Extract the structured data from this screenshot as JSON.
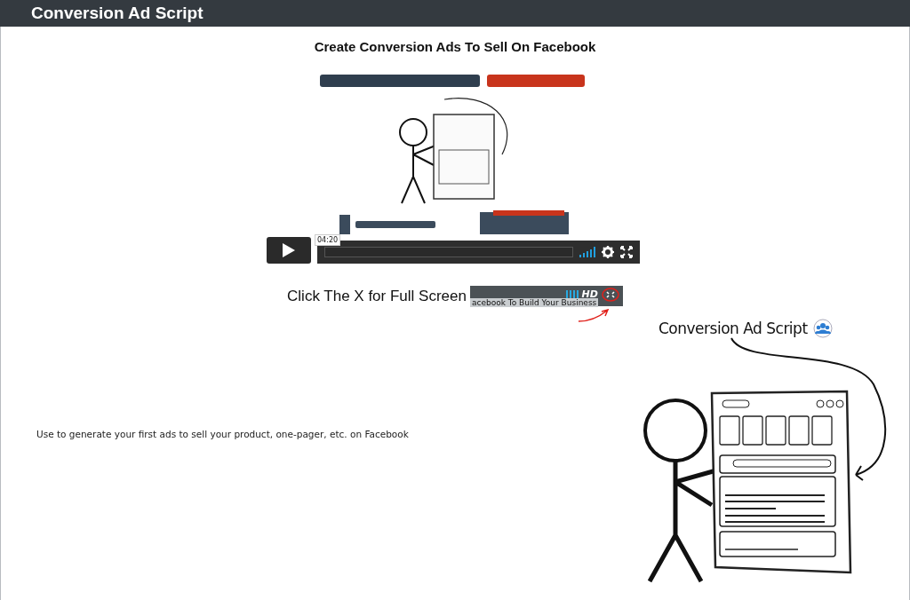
{
  "header": {
    "title": "Conversion Ad Script"
  },
  "heading": "Create Conversion Ads To Sell On Facebook",
  "video": {
    "kind": "picture",
    "time": "04:20"
  },
  "hint": {
    "text": "Click The X for Full Screen",
    "badge": "HD",
    "caption": "acebook To Build Your Business"
  },
  "description": "Use to generate your first ads to sell your product, one-pager, etc. on Facebook",
  "illustration": {
    "title": "Conversion Ad Script"
  }
}
